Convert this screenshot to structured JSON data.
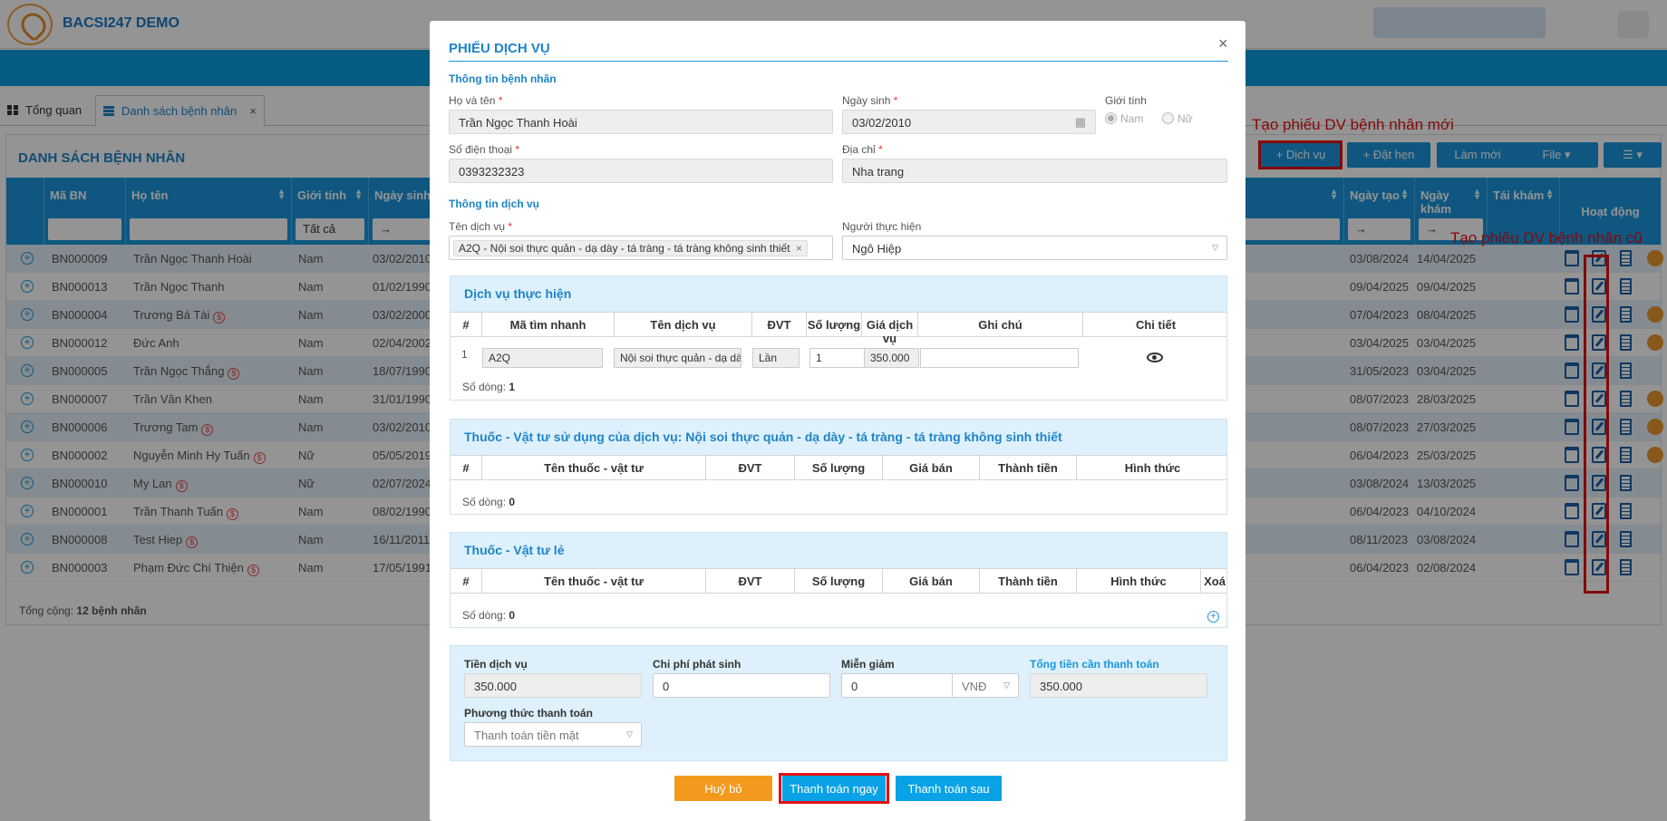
{
  "app": {
    "name": "BACSI247 DEMO",
    "logo_text": "BACSI247"
  },
  "tabs": [
    {
      "label": "Tổng quan",
      "icon": "grid-icon"
    },
    {
      "label": "Danh sách bệnh nhân",
      "icon": "list-icon",
      "close": "×"
    }
  ],
  "panel": {
    "title": "DANH SÁCH BỆNH NHÂN",
    "toolbar": {
      "dich_vu": "+ Dịch vụ",
      "dat_hen": "+ Đặt hẹn",
      "lam_moi": "Làm mới",
      "file": "File ▾",
      "menu": "☰ ▾"
    },
    "columns": {
      "ma_bn": "Mã BN",
      "ho_ten": "Họ tên",
      "gioi_tinh": "Giới tính",
      "ngay_sinh": "Ngày sinh",
      "ngay_tao": "Ngày tạo",
      "ngay_kham": "Ngày khám",
      "tai_kham": "Tái khám",
      "hoat_dong": "Hoạt động"
    },
    "filters": {
      "gioi_tinh": "Tất cả",
      "date_arrow": "→"
    },
    "rows": [
      {
        "ma": "BN000009",
        "ten": "Trần Ngọc Thanh Hoài",
        "money": false,
        "gt": "Nam",
        "ns": "03/02/2010",
        "nt": "03/08/2024",
        "nk": "14/04/2025",
        "pen": true
      },
      {
        "ma": "BN000013",
        "ten": "Trần Ngọc Thanh",
        "money": false,
        "gt": "Nam",
        "ns": "01/02/1990",
        "nt": "09/04/2025",
        "nk": "09/04/2025",
        "pen": false
      },
      {
        "ma": "BN000004",
        "ten": "Trương Bá Tài",
        "money": true,
        "gt": "Nam",
        "ns": "03/02/2000",
        "nt": "07/04/2023",
        "nk": "08/04/2025",
        "pen": true
      },
      {
        "ma": "BN000012",
        "ten": "Đức Anh",
        "money": false,
        "gt": "Nam",
        "ns": "02/04/2002",
        "nt": "03/04/2025",
        "nk": "03/04/2025",
        "pen": true
      },
      {
        "ma": "BN000005",
        "ten": "Trần Ngọc Thắng",
        "money": true,
        "gt": "Nam",
        "ns": "18/07/1990",
        "nt": "31/05/2023",
        "nk": "03/04/2025",
        "pen": false
      },
      {
        "ma": "BN000007",
        "ten": "Trần Văn Khen",
        "money": false,
        "gt": "Nam",
        "ns": "31/01/1990",
        "nt": "08/07/2023",
        "nk": "28/03/2025",
        "pen": true
      },
      {
        "ma": "BN000006",
        "ten": "Trương Tam",
        "money": true,
        "gt": "Nam",
        "ns": "03/02/2010",
        "nt": "08/07/2023",
        "nk": "27/03/2025",
        "pen": true
      },
      {
        "ma": "BN000002",
        "ten": "Nguyễn Minh Hy Tuấn",
        "money": true,
        "gt": "Nữ",
        "ns": "05/05/2019",
        "nt": "06/04/2023",
        "nk": "25/03/2025",
        "pen": true
      },
      {
        "ma": "BN000010",
        "ten": "My Lan",
        "money": true,
        "gt": "Nữ",
        "ns": "02/07/2024",
        "nt": "03/08/2024",
        "nk": "13/03/2025",
        "pen": false
      },
      {
        "ma": "BN000001",
        "ten": "Trần Thanh Tuấn",
        "money": true,
        "gt": "Nam",
        "ns": "08/02/1990",
        "nt": "06/04/2023",
        "nk": "04/10/2024",
        "pen": false
      },
      {
        "ma": "BN000008",
        "ten": "Test Hiep",
        "money": true,
        "gt": "Nam",
        "ns": "16/11/2011",
        "nt": "08/11/2023",
        "nk": "03/08/2024",
        "pen": false
      },
      {
        "ma": "BN000003",
        "ten": "Phạm Đức Chí Thiện",
        "money": true,
        "gt": "Nam",
        "ns": "17/05/1991",
        "nt": "06/04/2023",
        "nk": "02/08/2024",
        "pen": false
      }
    ],
    "total_prefix": "Tổng cộng:",
    "total_value": "12 bệnh nhân"
  },
  "annotations": {
    "new": "Tạo phiếu DV bệnh nhân mới",
    "old": "Tạo phiếu DV bệnh nhân cũ"
  },
  "modal": {
    "title": "PHIẾU DỊCH VỤ",
    "close": "×",
    "patient_section": "Thông tin bệnh nhân",
    "ho_ten_label": "Họ và tên",
    "ho_ten": "Trần Ngọc Thanh Hoài",
    "ngay_sinh_label": "Ngày sinh",
    "ngay_sinh": "03/02/2010",
    "gioi_tinh_label": "Giới tính",
    "nam": "Nam",
    "nu": "Nữ",
    "sdt_label": "Số điện thoại",
    "sdt": "0393232323",
    "dia_chi_label": "Địa chỉ",
    "dia_chi": "Nha trang",
    "service_section": "Thông tin dịch vụ",
    "ten_dv_label": "Tên dịch vụ",
    "ten_dv_tag": "A2Q - Nội soi thực quản - dạ dày - tá tràng - tá tràng không sinh thiết",
    "tag_remove": "×",
    "nguoi_th_label": "Người thực hiện",
    "nguoi_th": "Ngô Hiệp",
    "dv_box": {
      "title": "Dịch vụ thực hiện",
      "cols": [
        "#",
        "Mã tìm nhanh",
        "Tên dịch vụ",
        "ĐVT",
        "Số lượng",
        "Giá dịch vụ",
        "Ghi chú",
        "Chi tiết"
      ],
      "row": {
        "stt": "1",
        "ma": "A2Q",
        "ten": "Nội soi thực quản - dạ dày - tá tràng",
        "dvt": "Lần",
        "sl": "1",
        "gia": "350.000",
        "ghichu": ""
      },
      "so_dong_label": "Số dòng:",
      "so_dong": "1"
    },
    "thuoc_box": {
      "title": "Thuốc - Vật tư sử dụng của dịch vụ: Nội soi thực quản - dạ dày - tá tràng - tá tràng không sinh thiết",
      "cols": [
        "#",
        "Tên thuốc - vật tư",
        "ĐVT",
        "Số lượng",
        "Giá bán",
        "Thành tiền",
        "Hình thức"
      ],
      "so_dong_label": "Số dòng:",
      "so_dong": "0"
    },
    "le_box": {
      "title": "Thuốc - Vật tư lẻ",
      "cols": [
        "#",
        "Tên thuốc - vật tư",
        "ĐVT",
        "Số lượng",
        "Giá bán",
        "Thành tiền",
        "Hình thức",
        "Xoá"
      ],
      "so_dong_label": "Số dòng:",
      "so_dong": "0"
    },
    "payment": {
      "tien_dv_label": "Tiền dịch vụ",
      "tien_dv": "350.000",
      "chi_phi_label": "Chi phí phát sinh",
      "chi_phi": "0",
      "mien_giam_label": "Miễn giảm",
      "mien_giam": "0",
      "currency": "VNĐ",
      "tong_label": "Tổng tiền cần thanh toán",
      "tong": "350.000",
      "pttt_label": "Phương thức thanh toán",
      "pttt": "Thanh toán tiền mặt"
    },
    "buttons": {
      "huy": "Huỷ bỏ",
      "ngay": "Thanh toán ngay",
      "sau": "Thanh toán sau"
    }
  },
  "colors": {
    "primary": "#1a96dd",
    "orange": "#f39a1e",
    "red_annotation": "#e31010"
  }
}
